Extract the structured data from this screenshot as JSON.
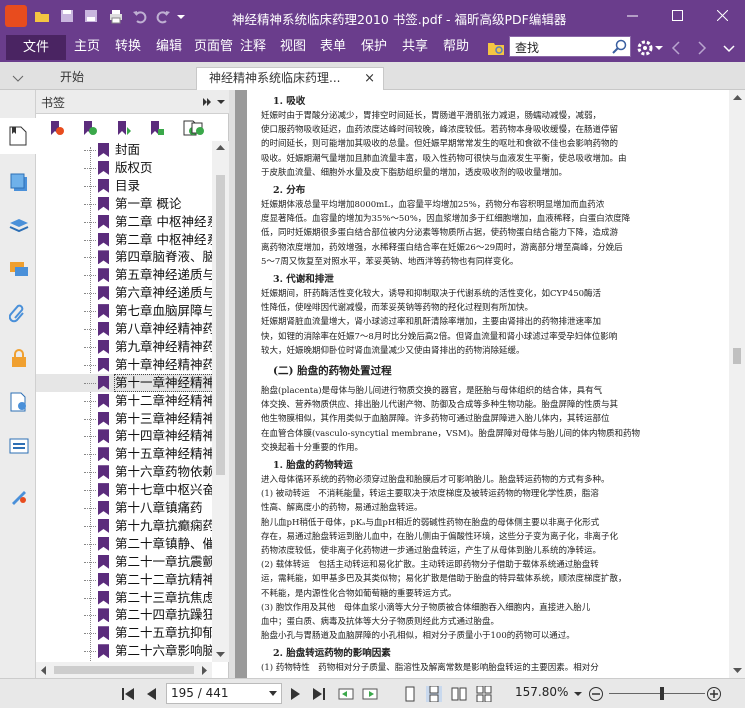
{
  "window": {
    "title": "神经精神系统临床药理2010 书签.pdf - 福昕高级PDF编辑器",
    "quick_access_icons": [
      "open-folder-icon",
      "save-icon",
      "save-as-icon",
      "print-icon",
      "undo-icon",
      "redo-icon",
      "customize-icon"
    ]
  },
  "menu": {
    "file": "文件",
    "items": [
      "主页",
      "转换",
      "编辑",
      "页面管",
      "注释",
      "视图",
      "表单",
      "保护",
      "共享",
      "帮助"
    ]
  },
  "search": {
    "value": "查找"
  },
  "tabs": [
    {
      "label": "开始"
    },
    {
      "label": "神经精神系统临床药理..."
    }
  ],
  "bookmarks_panel": {
    "title": "书签",
    "items": [
      "封面",
      "版权页",
      "目录",
      "第一章 概论",
      "第二章 中枢神经系统的组",
      "第二章 中枢神经系统的解",
      "第四章脑脊液、脑血流及",
      "第五章神经递质与神经调",
      "第六章神经递质与神经精",
      "第七章血脑屏障与药物治",
      "第八章神经精神药物的药",
      "第九章神经精神药物的药",
      "第十章神经精神药物的遗",
      "第十一章神经精神药物的",
      "第十二章神经精神药物的",
      "第十三章神经精神疾病对",
      "第十四章神经精神药物与",
      "第十五章神经精神药物的",
      "第十六章药物依赖性与社",
      "第十七章中枢兴奋药",
      "第十八章镇痛药",
      "第十九章抗癫痫药",
      "第二十章镇静、催眠及抗",
      "第二十一章抗震颤麻痹药",
      "第二十二章抗精神病药物",
      "第二十三章抗焦虑药",
      "第二十四章抗躁狂及多动",
      "第二十五章抗抑郁药",
      "第二十六章影响脑血管、"
    ],
    "selected_index": 13
  },
  "document": {
    "lines": [
      {
        "t": "1. 吸收",
        "s": "h"
      },
      {
        "t": "妊娠时由于胃酸分泌减少，胃排空时间延长，胃肠道平滑肌张力减退，肠蠕动减慢，减弱，"
      },
      {
        "t": "使口服药物吸收延迟，血药浓度达峰时间较晚，峰浓度较低。若药物本身吸收缓慢，在肠道停留"
      },
      {
        "t": "的时间延长，则可能增加其吸收的总量。但妊娠早期常常发生的呕吐和食欲不佳也会影响药物的"
      },
      {
        "t": "吸收。妊娠期潮气量增加且肺血流量丰富，吸入性药物可很快与血液发生平衡，使总吸收增加。由"
      },
      {
        "t": "于皮肤血流量、细胞外水量及皮下脂肪组织量的增加，透皮吸收剂的吸收量增加。"
      },
      {
        "t": "2. 分布",
        "s": "h"
      },
      {
        "t": "妊娠期体液总量平均增加8000mL，血容量平均增加25%，药物分布容积明显增加而血药浓"
      },
      {
        "t": "度显著降低。血容量的增加为35%～50%，因血浆增加多于红细胞增加，血液稀释，白蛋白浓度降"
      },
      {
        "t": "低，同时妊娠期很多蛋白结合部位被内分泌素等物质所占据，使药物蛋白结合能力下降，造成游"
      },
      {
        "t": "离药物浓度增加，药效增强，水稀释蛋白结合率在妊娠26～29周时，游离部分增至高峰，分娩后"
      },
      {
        "t": "5～7周又恢复至对照水平，苯妥英钠、地西泮等药物也有同样变化。"
      },
      {
        "t": "3. 代谢和排泄",
        "s": "h"
      },
      {
        "t": "妊娠期间，肝药酶活性变化较大，诱导和抑制取决于代谢系统的活性变化，如CYP450酶活"
      },
      {
        "t": "性降低，使唑啡因代谢减慢，而苯妥英钠等药物的羟化过程则有所加快。"
      },
      {
        "t": "妊娠期肾脏血流量增大，肾小球滤过率和肌酐清除率增加，主要由肾排出的药物排泄速率加"
      },
      {
        "t": "快，如锂的消除率在妊娠7～8月时比分娩后高2倍。但肾血流量和肾小球滤过率受孕妇体位影响"
      },
      {
        "t": "较大，妊娠晚期仰卧位时肾血流量减少又使由肾排出的药物消除延缓。"
      },
      {
        "t": "(二) 胎盘的药物处置过程",
        "s": "h2"
      },
      {
        "t": "胎盘(placenta)是母体与胎儿间进行物质交换的器官，是胚胎与母体组织的结合体，具有气"
      },
      {
        "t": "体交换、营养物质供应、排出胎儿代谢产物、防御及合成等多种生物功能。胎盘屏障的性质与其"
      },
      {
        "t": "他生物膜相似，其作用类似于血脑屏障。许多药物可通过胎盘屏障进入胎儿体内，其转运部位"
      },
      {
        "t": "在血管合体膜(vasculo-syncytial membrane，VSM)。胎盘屏障对母体与胎儿间的体内物质和药物"
      },
      {
        "t": "交换起着十分重要的作用。"
      },
      {
        "t": "1. 胎盘的药物转运",
        "s": "h"
      },
      {
        "t": "进入母体循环系统的药物必须穿过胎盘和胎膜后才可影响胎儿。胎盘转运药物的方式有多种。"
      },
      {
        "t": "(1) 被动转运　不消耗能量，转运主要取决于浓度梯度及被转运药物的物理化学性质，脂溶"
      },
      {
        "t": "性高、解离度小的药物，易通过胎盘转运。"
      },
      {
        "t": "胎儿血pH稍低于母体，pKₐ与血pH相近的弱碱性药物在胎盘的母体侧主要以非离子化形式"
      },
      {
        "t": "存在，易通过胎盘转运到胎儿血中，在胎儿侧由于偏酸性环境，这些分子变为离子化，非离子化"
      },
      {
        "t": "药物浓度较低，使非离子化药物进一步通过胎盘转运，产生了从母体到胎儿系统的净转运。"
      },
      {
        "t": "(2) 载体转运　包括主动转运和易化扩散。主动转运即药物分子借助于载体系统通过胎盘转"
      },
      {
        "t": "运，需耗能，如甲基多巴及其类似物；易化扩散是借助于胎盘的特异载体系统，顺浓度梯度扩散，"
      },
      {
        "t": "不耗能，是内源性化合物如葡萄糖的重要转运方式。"
      },
      {
        "t": "(3) 胞饮作用及其他　母体血浆小滴等大分子物质被合体细胞吞入细胞内，直接进入胎儿"
      },
      {
        "t": "血中；蛋白质、病毒及抗体等大分子物质则经此方式通过胎盘。"
      },
      {
        "t": "胎盘小孔与胃肠道及血脑屏障的小孔相似，相对分子质量小于100的药物可以通过。"
      },
      {
        "t": "2. 胎盘转运药物的影响因素",
        "s": "h"
      },
      {
        "t": "(1) 药物特性　药物相对分子质量、脂溶性及解离常数是影响胎盘转运的主要因素。相对分"
      }
    ]
  },
  "status": {
    "page_field": "195 / 441",
    "zoom": "157.80%"
  }
}
